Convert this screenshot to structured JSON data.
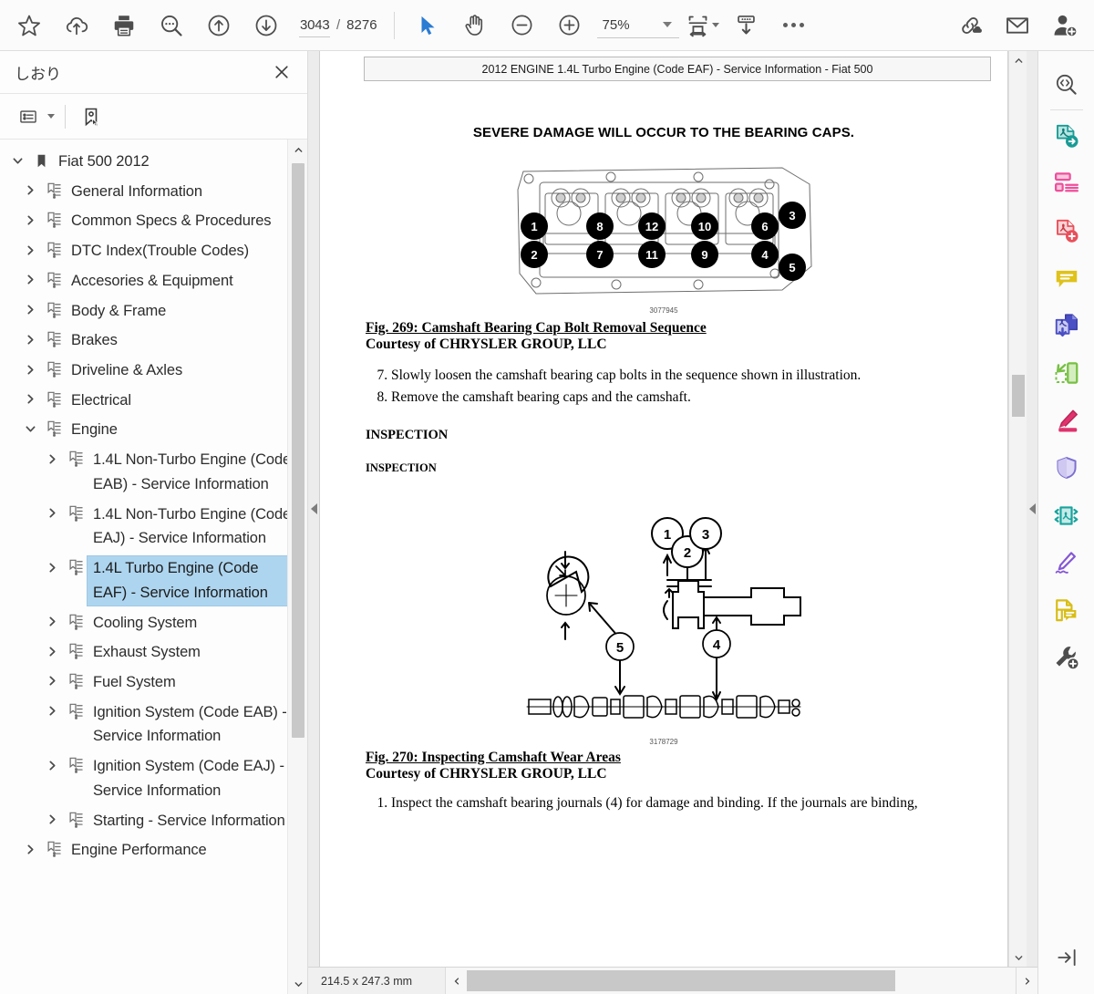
{
  "toolbar": {
    "star_label": "star-favorite",
    "upload_label": "upload-cloud",
    "print_label": "print",
    "search_label": "search",
    "prev_label": "previous-page",
    "next_label": "next-page",
    "page_current": "3043",
    "page_separator": "/",
    "page_total": "8276",
    "select_label": "select-tool",
    "hand_label": "hand-tool",
    "zoom_out_label": "zoom-out",
    "zoom_in_label": "zoom-in",
    "zoom_value": "75%",
    "fit_label": "fit-page",
    "save_label": "save-download",
    "more_label": "more-options",
    "link_label": "share-link",
    "mail_label": "send-mail",
    "adduser_label": "add-user"
  },
  "sidebar": {
    "title": "しおり",
    "close_label": "Close",
    "tool_list_label": "list-options",
    "tool_bookmark_label": "bookmark-select",
    "tree": [
      {
        "label": "Fiat 500 2012",
        "level": 0,
        "state": "expanded",
        "icon": "bookmark",
        "selected": false
      },
      {
        "label": "General Information",
        "level": 1,
        "state": "collapsed",
        "icon": "chapter",
        "selected": false
      },
      {
        "label": "Common Specs & Procedures",
        "level": 1,
        "state": "collapsed",
        "icon": "chapter",
        "selected": false
      },
      {
        "label": "DTC Index(Trouble Codes)",
        "level": 1,
        "state": "collapsed",
        "icon": "chapter",
        "selected": false
      },
      {
        "label": "Accesories & Equipment",
        "level": 1,
        "state": "collapsed",
        "icon": "chapter",
        "selected": false
      },
      {
        "label": "Body & Frame",
        "level": 1,
        "state": "collapsed",
        "icon": "chapter",
        "selected": false
      },
      {
        "label": "Brakes",
        "level": 1,
        "state": "collapsed",
        "icon": "chapter",
        "selected": false
      },
      {
        "label": "Driveline & Axles",
        "level": 1,
        "state": "collapsed",
        "icon": "chapter",
        "selected": false
      },
      {
        "label": "Electrical",
        "level": 1,
        "state": "collapsed",
        "icon": "chapter",
        "selected": false
      },
      {
        "label": "Engine",
        "level": 1,
        "state": "expanded",
        "icon": "chapter",
        "selected": false
      },
      {
        "label": "1.4L Non-Turbo Engine (Code EAB) - Service Information",
        "level": 2,
        "state": "collapsed",
        "icon": "chapter",
        "selected": false
      },
      {
        "label": "1.4L Non-Turbo Engine (Code EAJ) - Service Information",
        "level": 2,
        "state": "collapsed",
        "icon": "chapter",
        "selected": false
      },
      {
        "label": "1.4L Turbo Engine (Code EAF) - Service Information",
        "level": 2,
        "state": "collapsed",
        "icon": "chapter",
        "selected": true
      },
      {
        "label": "Cooling System",
        "level": 2,
        "state": "collapsed",
        "icon": "chapter",
        "selected": false
      },
      {
        "label": "Exhaust System",
        "level": 2,
        "state": "collapsed",
        "icon": "chapter",
        "selected": false
      },
      {
        "label": "Fuel System",
        "level": 2,
        "state": "collapsed",
        "icon": "chapter",
        "selected": false
      },
      {
        "label": "Ignition System (Code EAB) - Service Information",
        "level": 2,
        "state": "collapsed",
        "icon": "chapter",
        "selected": false
      },
      {
        "label": "Ignition System (Code EAJ) - Service Information",
        "level": 2,
        "state": "collapsed",
        "icon": "chapter",
        "selected": false
      },
      {
        "label": "Starting - Service Information",
        "level": 2,
        "state": "collapsed",
        "icon": "chapter",
        "selected": false
      },
      {
        "label": "Engine Performance",
        "level": 1,
        "state": "collapsed",
        "icon": "chapter",
        "selected": false
      }
    ]
  },
  "document": {
    "running_header": "2012 ENGINE 1.4L Turbo Engine (Code EAF) - Service Information - Fiat 500",
    "warning": "SEVERE DAMAGE WILL OCCUR TO THE BEARING CAPS.",
    "fig269": {
      "image_code": "3077945",
      "title": "Fig. 269: Camshaft Bearing Cap Bolt Removal Sequence",
      "courtesy": "Courtesy of CHRYSLER GROUP, LLC",
      "callouts_top": [
        "1",
        "8",
        "12",
        "10",
        "6",
        "3"
      ],
      "callouts_bottom": [
        "2",
        "7",
        "11",
        "9",
        "4",
        "5"
      ]
    },
    "steps_a": [
      {
        "num": "7.",
        "text": "Slowly loosen the camshaft bearing cap bolts in the sequence shown in illustration."
      },
      {
        "num": "8.",
        "text": "Remove the camshaft bearing caps and the camshaft."
      }
    ],
    "heading_1": "INSPECTION",
    "heading_2": "INSPECTION",
    "fig270": {
      "image_code": "3178729",
      "title": "Fig. 270: Inspecting Camshaft Wear Areas",
      "courtesy": "Courtesy of CHRYSLER GROUP, LLC",
      "callouts": [
        "1",
        "2",
        "3",
        "4",
        "5"
      ]
    },
    "steps_b": [
      {
        "num": "1.",
        "text": "Inspect the camshaft bearing journals (4) for damage and binding. If the journals are binding, "
      }
    ]
  },
  "statusbar": {
    "page_size": "214.5 x 247.3 mm",
    "scroll_left_label": "scroll-left",
    "scroll_right_label": "scroll-right"
  },
  "rail": {
    "items": [
      {
        "name": "search-document",
        "color": "#4d4d4d"
      },
      {
        "name": "pdf-convert",
        "color": "#1a9b95"
      },
      {
        "name": "page-layout",
        "color": "#ef4f9b"
      },
      {
        "name": "pdf-add",
        "color": "#e8505b"
      },
      {
        "name": "comment",
        "color": "#dfc21a"
      },
      {
        "name": "pdf-download",
        "color": "#4a4fc4"
      },
      {
        "name": "extract-page",
        "color": "#77c043"
      },
      {
        "name": "highlight",
        "color": "#e0336e"
      },
      {
        "name": "protect",
        "color": "#7b6fd0"
      },
      {
        "name": "compress-pdf",
        "color": "#18a39c"
      },
      {
        "name": "sign",
        "color": "#8557d6"
      },
      {
        "name": "page-note",
        "color": "#d8bd16"
      },
      {
        "name": "tools-add",
        "color": "#4d4d4d"
      }
    ],
    "collapse_label": "collapse-rail"
  }
}
